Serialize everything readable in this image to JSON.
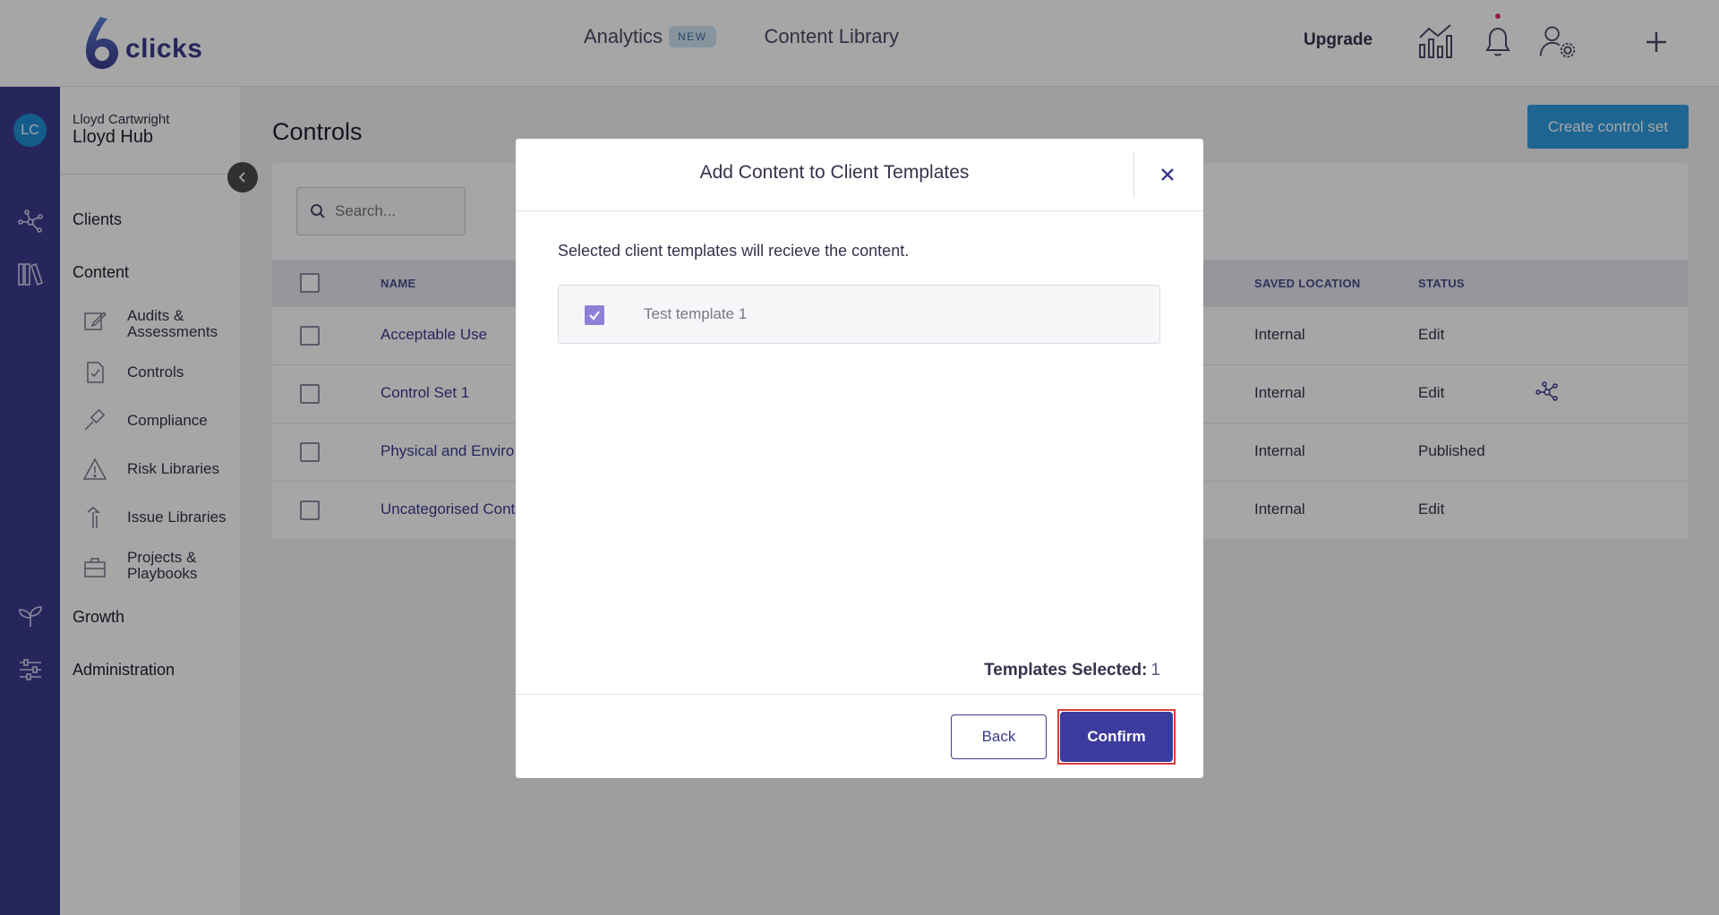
{
  "brand": {
    "logo_text": "clicks"
  },
  "topnav": {
    "analytics": "Analytics",
    "analytics_badge": "NEW",
    "content_library": "Content Library",
    "upgrade": "Upgrade"
  },
  "user": {
    "initials": "LC",
    "owner": "Lloyd Cartwright",
    "hub": "Lloyd Hub"
  },
  "sidebar": {
    "clients": "Clients",
    "content": "Content",
    "items": [
      {
        "label": "Audits & Assessments"
      },
      {
        "label": "Controls"
      },
      {
        "label": "Compliance"
      },
      {
        "label": "Risk Libraries"
      },
      {
        "label": "Issue Libraries"
      },
      {
        "label": "Projects & Playbooks"
      }
    ],
    "growth": "Growth",
    "administration": "Administration"
  },
  "page": {
    "title": "Controls",
    "create_button": "Create control set",
    "search_placeholder": "Search..."
  },
  "table": {
    "headers": {
      "name": "NAME",
      "saved_location": "SAVED LOCATION",
      "status": "STATUS"
    },
    "rows": [
      {
        "name": "Acceptable Use",
        "location": "Internal",
        "status": "Edit"
      },
      {
        "name": "Control Set 1",
        "location": "Internal",
        "status": "Edit"
      },
      {
        "name": "Physical and Enviro",
        "location": "Internal",
        "status": "Published"
      },
      {
        "name": "Uncategorised Cont",
        "location": "Internal",
        "status": "Edit"
      }
    ]
  },
  "modal": {
    "title": "Add Content to Client Templates",
    "description": "Selected client templates will recieve the content.",
    "templates": [
      {
        "name": "Test template 1",
        "checked": true
      }
    ],
    "selected_label": "Templates Selected:",
    "selected_count": "1",
    "back": "Back",
    "confirm": "Confirm"
  },
  "colors": {
    "brand": "#3c3b8e",
    "accent": "#2f9be0",
    "highlight": "#e33b3b"
  }
}
